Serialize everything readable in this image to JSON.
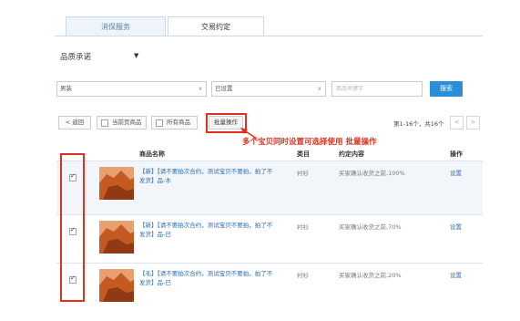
{
  "tabs": [
    {
      "label": "消保服务",
      "active": false
    },
    {
      "label": "交易约定",
      "active": true
    }
  ],
  "quality_select": {
    "label": "品质承诺"
  },
  "filters": {
    "category_value": "男装",
    "status_value": "已设置",
    "search_placeholder": "商品关键字",
    "search_button": "搜索"
  },
  "actions": {
    "back": "< 返回",
    "current_page": "当前页商品",
    "all_items": "所有商品",
    "batch": "批量操作",
    "page_info": "第1-16个，共16个",
    "prev": "<",
    "next": ">"
  },
  "annotation": "多个宝贝同时设置可选择使用  批量操作",
  "table": {
    "headers": {
      "name": "商品名称",
      "category": "类目",
      "content": "约定内容",
      "op": "操作"
    },
    "rows": [
      {
        "title": "【新】【请不要拍次合约，测试宝贝不要拍，拍了不发货】品-木",
        "category": "衬衫",
        "content": "买家确认收货之前,100%",
        "op": "设置",
        "checked": true
      },
      {
        "title": "【新】【请不要拍次合约，测试宝贝不要拍，拍了不发货】品-已",
        "category": "衬衫",
        "content": "买家确认收货之前,70%",
        "op": "设置",
        "checked": true
      },
      {
        "title": "【毛】【请不要拍次合约，测试宝贝不要拍，拍了不发货】品-已",
        "category": "衬衫",
        "content": "买家确认收货之前,20%",
        "op": "设置",
        "checked": true
      }
    ]
  },
  "colors": {
    "accent": "#2a8fd8",
    "highlight": "#e0301e",
    "link": "#2a6ebb"
  }
}
